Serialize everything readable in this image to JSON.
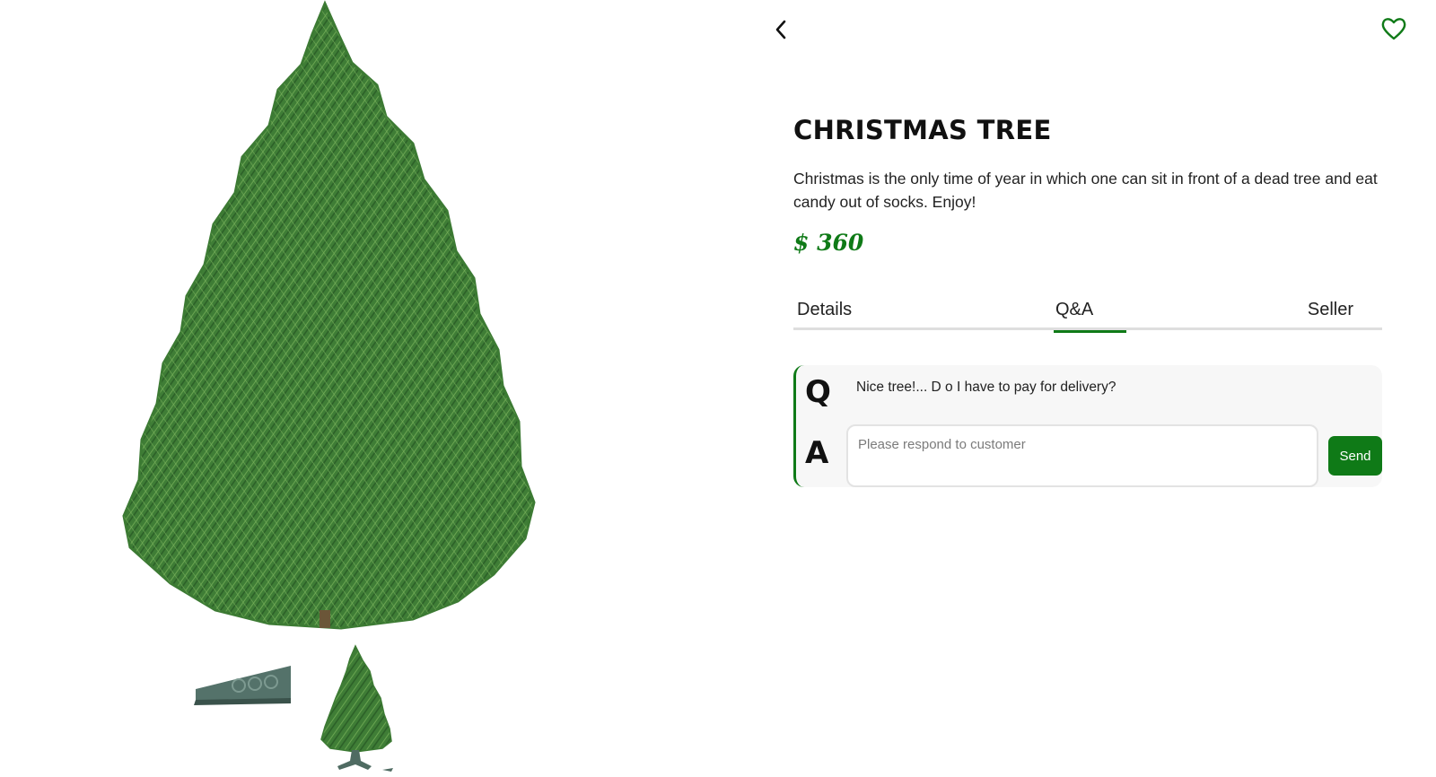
{
  "product": {
    "title": "CHRISTMAS TREE",
    "description": "Christmas is the only time of year in which one can sit in front of a dead tree and eat candy out of socks. Enjoy!",
    "price": "$ 360"
  },
  "nav": {
    "back_icon": "chevron-left-icon",
    "favorite_icon": "heart-outline-icon"
  },
  "tabs": [
    {
      "label": "Details",
      "active": false
    },
    {
      "label": "Q&A",
      "active": true
    },
    {
      "label": "Seller",
      "active": false
    }
  ],
  "qa": {
    "question_marker": "Q",
    "answer_marker": "A",
    "question": "Nice tree!... D o I have to pay for delivery?",
    "answer_placeholder": "Please respond to customer",
    "answer_value": "",
    "send_label": "Send"
  },
  "gallery": {
    "main_image": "christmas-tree-photo",
    "thumbnails": [
      "tree-stand-photo",
      "christmas-tree-thumbnail"
    ]
  },
  "colors": {
    "accent": "#0f7a17",
    "tree_dark": "#2e6b2a",
    "tree_light": "#5a9a45",
    "stand": "#4f6b62"
  }
}
